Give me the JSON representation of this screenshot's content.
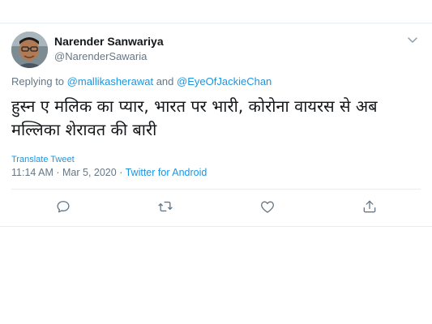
{
  "tweet": {
    "author": {
      "name": "Narender Sanwariya",
      "handle": "@NarenderSawaria",
      "avatar_icon": "user-avatar"
    },
    "reply": {
      "prefix": "Replying to",
      "mention1": "@mallikasherawat",
      "conjunction": "and",
      "mention2": "@EyeOfJackieChan"
    },
    "text": "हुस्न ए मलिक का प्यार, भारत पर भारी, कोरोना वायरस से अब मल्लिका शेरावत की बारी",
    "translate_label": "Translate Tweet",
    "timestamp": "11:14 AM · Mar 5, 2020",
    "separator": "·",
    "source": "Twitter for Android"
  },
  "actions": {
    "reply_icon": "comment-icon",
    "retweet_icon": "retweet-icon",
    "like_icon": "heart-icon",
    "share_icon": "share-icon"
  },
  "colors": {
    "link": "#1b95e0",
    "secondary_text": "#657786",
    "primary_text": "#14171a",
    "divider": "#e6ecf0"
  }
}
